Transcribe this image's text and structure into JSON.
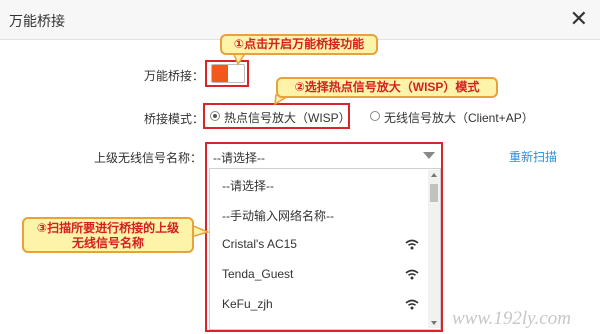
{
  "dialog": {
    "title": "万能桥接"
  },
  "form": {
    "bridge_label": "万能桥接：",
    "mode_label": "桥接模式：",
    "ssid_label": "上级无线信号名称："
  },
  "toggle": {
    "state": "on"
  },
  "modes": {
    "wisp": {
      "label": "热点信号放大（WISP）",
      "selected": true
    },
    "client_ap": {
      "label": "无线信号放大（Client+AP）",
      "selected": false
    }
  },
  "ssid_select": {
    "value": "--请选择--",
    "rescan_label": "重新扫描",
    "options": [
      {
        "label": "--请选择--",
        "wifi": false
      },
      {
        "label": "--手动输入网络名称--",
        "wifi": false
      },
      {
        "label": "Cristal's AC15",
        "wifi": true
      },
      {
        "label": "Tenda_Guest",
        "wifi": true
      },
      {
        "label": "KeFu_zjh",
        "wifi": true
      }
    ]
  },
  "callouts": {
    "step1": "①点击开启万能桥接功能",
    "step2": "②选择热点信号放大（WISP）模式",
    "step3": "③扫描所要进行桥接的上级无线信号名称"
  },
  "watermark": "www.192ly.com",
  "colors": {
    "accent": "#f1581c",
    "highlight": "#d9252a",
    "link": "#2a8fd6",
    "callout_bg": "#fdf3a9"
  },
  "icons": {
    "close": "close-icon",
    "wifi": "wifi-icon",
    "dropdown": "chevron-down-icon"
  }
}
